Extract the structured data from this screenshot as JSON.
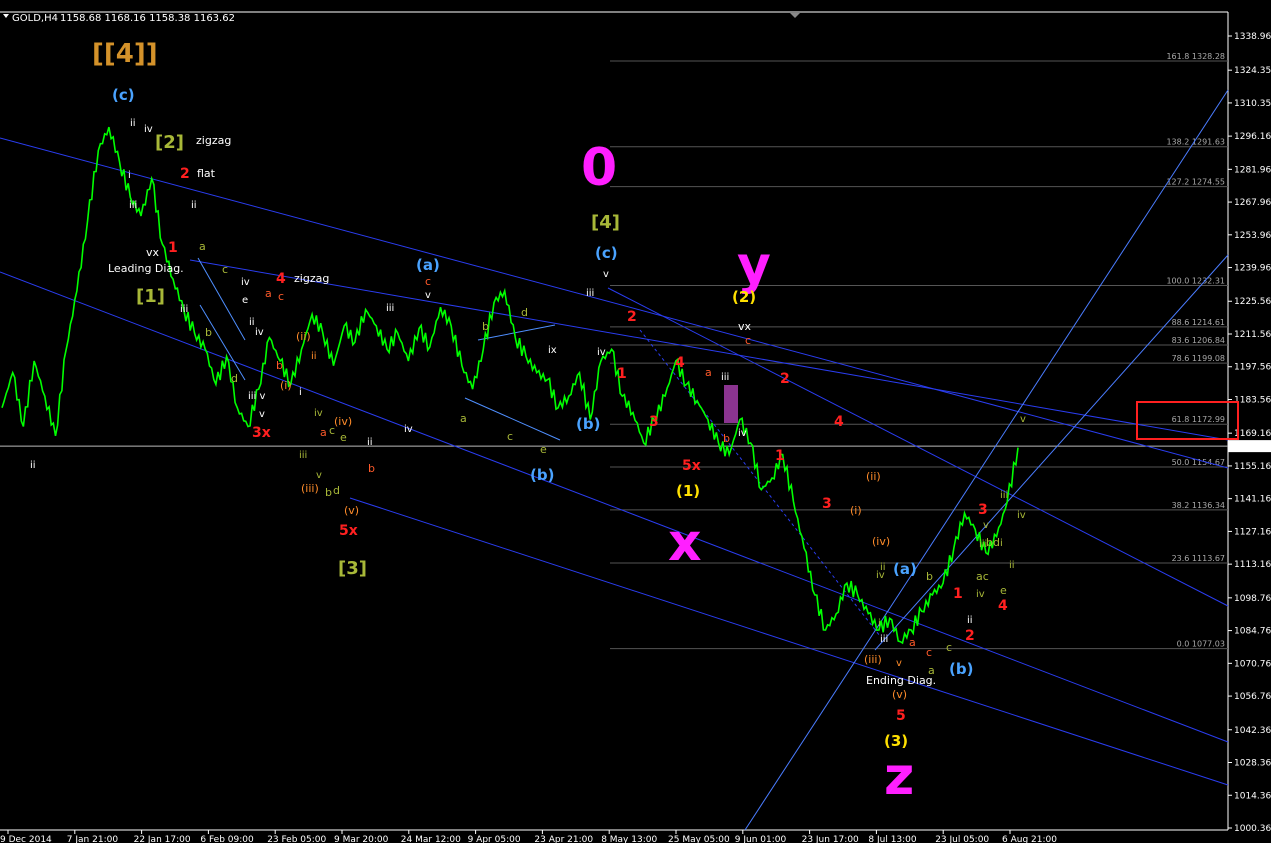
{
  "chart_data": {
    "type": "line",
    "header": {
      "symbol": "GOLD,H4",
      "ohlc": "1158.68 1168.16 1158.38 1163.62"
    },
    "ylim": [
      1000,
      1345
    ],
    "y_ticks": [
      "1338.96",
      "1324.35",
      "1310.35",
      "1296.16",
      "1281.96",
      "1267.96",
      "1253.96",
      "1239.96",
      "1225.56",
      "1211.56",
      "1197.56",
      "1183.56",
      "1169.16",
      "1155.16",
      "1141.16",
      "1127.16",
      "1113.16",
      "1098.76",
      "1084.76",
      "1070.76",
      "1056.76",
      "1042.36",
      "1028.36",
      "1014.36",
      "1000.36"
    ],
    "x_ticks": [
      "9 Dec 2014",
      "7 Jan 21:00",
      "22 Jan 17:00",
      "6 Feb 09:00",
      "23 Feb 05:00",
      "9 Mar 20:00",
      "24 Mar 12:00",
      "9 Apr 05:00",
      "23 Apr 21:00",
      "8 May 13:00",
      "25 May 05:00",
      "9 Jun 01:00",
      "23 Jun 17:00",
      "8 Jul 13:00",
      "23 Jul 05:00",
      "6 Aug 21:00"
    ],
    "current_price": "1163.62",
    "series": [
      {
        "color": "#00ff00",
        "values": [
          1180,
          1195,
          1172,
          1200,
          1185,
          1168,
          1205,
          1230,
          1260,
          1290,
          1300,
          1285,
          1270,
          1262,
          1278,
          1250,
          1235,
          1222,
          1212,
          1205,
          1190,
          1202,
          1180,
          1172,
          1188,
          1210,
          1200,
          1190,
          1205,
          1220,
          1212,
          1198,
          1215,
          1208,
          1222,
          1215,
          1205,
          1212,
          1200,
          1214,
          1206,
          1223,
          1215,
          1198,
          1188,
          1205,
          1225,
          1230,
          1210,
          1202,
          1195,
          1192,
          1180,
          1185,
          1195,
          1175,
          1200,
          1205,
          1185,
          1178,
          1165,
          1175,
          1185,
          1200,
          1190,
          1183,
          1175,
          1165,
          1160,
          1175,
          1165,
          1145,
          1150,
          1160,
          1140,
          1120,
          1100,
          1085,
          1092,
          1105,
          1100,
          1092,
          1085,
          1090,
          1080,
          1085,
          1093,
          1100,
          1105,
          1120,
          1135,
          1128,
          1118,
          1125,
          1140,
          1163
        ]
      }
    ],
    "fibonacci": {
      "color": "#555555",
      "levels": [
        {
          "label": "161.8",
          "value": "1328.28"
        },
        {
          "label": "138.2",
          "value": "1291.63"
        },
        {
          "label": "127.2",
          "value": "1274.55"
        },
        {
          "label": "100.0",
          "value": "1232.31"
        },
        {
          "label": "88.6",
          "value": "1214.61"
        },
        {
          "label": "83.6",
          "value": "1206.84"
        },
        {
          "label": "78.6",
          "value": "1199.08"
        },
        {
          "label": "61.8",
          "value": "1172.99"
        },
        {
          "label": "50.0",
          "value": "1154.67"
        },
        {
          "label": "38.2",
          "value": "1136.34"
        },
        {
          "label": "23.6",
          "value": "1113.67"
        },
        {
          "label": "0.0",
          "value": "1077.03"
        }
      ]
    },
    "annotations": [
      {
        "text": "[[4]]",
        "color": "#d4922a",
        "size": 26
      },
      {
        "text": "(c)",
        "color": "#4aa3ff",
        "size": 15
      },
      {
        "text": "ii",
        "color": "#ffffff",
        "size": 10
      },
      {
        "text": "iv",
        "color": "#ffffff",
        "size": 10
      },
      {
        "text": "[2]",
        "color": "#a8b838",
        "size": 18
      },
      {
        "text": "zigzag",
        "color": "#ffffff",
        "size": 11
      },
      {
        "text": "2",
        "color": "#ff2020",
        "size": 14
      },
      {
        "text": "flat",
        "color": "#ffffff",
        "size": 11
      },
      {
        "text": "i",
        "color": "#ffffff",
        "size": 10
      },
      {
        "text": "iii",
        "color": "#ffffff",
        "size": 10
      },
      {
        "text": "ii",
        "color": "#ffffff",
        "size": 10
      },
      {
        "text": "vx",
        "color": "#ffffff",
        "size": 11
      },
      {
        "text": "1",
        "color": "#ff2020",
        "size": 14
      },
      {
        "text": "Leading Diag.",
        "color": "#ffffff",
        "size": 11
      },
      {
        "text": "[1]",
        "color": "#a8b838",
        "size": 18
      },
      {
        "text": "iii",
        "color": "#ffffff",
        "size": 10
      },
      {
        "text": "a",
        "color": "#a8b838",
        "size": 11
      },
      {
        "text": "c",
        "color": "#a8b838",
        "size": 11
      },
      {
        "text": "iv",
        "color": "#ffffff",
        "size": 10
      },
      {
        "text": "e",
        "color": "#ffffff",
        "size": 10
      },
      {
        "text": "4",
        "color": "#ff2020",
        "size": 14
      },
      {
        "text": "zigzag",
        "color": "#ffffff",
        "size": 11
      },
      {
        "text": "b",
        "color": "#a8b838",
        "size": 11
      },
      {
        "text": "d",
        "color": "#a8b838",
        "size": 11
      },
      {
        "text": "ii",
        "color": "#ffffff",
        "size": 10
      },
      {
        "text": "iv",
        "color": "#ffffff",
        "size": 10
      },
      {
        "text": "a",
        "color": "#ff5a2a",
        "size": 11
      },
      {
        "text": "c",
        "color": "#ff5a2a",
        "size": 11
      },
      {
        "text": "(ii)",
        "color": "#ff8c2a",
        "size": 11
      },
      {
        "text": "ii",
        "color": "#ff8c2a",
        "size": 10
      },
      {
        "text": "b",
        "color": "#ff5a2a",
        "size": 11
      },
      {
        "text": "(i)",
        "color": "#ff8c2a",
        "size": 11
      },
      {
        "text": "iii v",
        "color": "#ffffff",
        "size": 10
      },
      {
        "text": "v",
        "color": "#ffffff",
        "size": 10
      },
      {
        "text": "3x",
        "color": "#ff2020",
        "size": 14
      },
      {
        "text": "i",
        "color": "#ffffff",
        "size": 10
      },
      {
        "text": "iv",
        "color": "#a8b838",
        "size": 10
      },
      {
        "text": "(iv)",
        "color": "#ff8c2a",
        "size": 11
      },
      {
        "text": "a",
        "color": "#ff5a2a",
        "size": 11
      },
      {
        "text": "c",
        "color": "#a8b838",
        "size": 11
      },
      {
        "text": "e",
        "color": "#a8b838",
        "size": 11
      },
      {
        "text": "iii",
        "color": "#a8b838",
        "size": 10
      },
      {
        "text": "v",
        "color": "#a8b838",
        "size": 10
      },
      {
        "text": "b",
        "color": "#a8b838",
        "size": 11
      },
      {
        "text": "d",
        "color": "#a8b838",
        "size": 11
      },
      {
        "text": "(iii)",
        "color": "#ff8c2a",
        "size": 11
      },
      {
        "text": "(v)",
        "color": "#ff8c2a",
        "size": 11
      },
      {
        "text": "5x",
        "color": "#ff2020",
        "size": 14
      },
      {
        "text": "[3]",
        "color": "#a8b838",
        "size": 18
      },
      {
        "text": "ii",
        "color": "#ffffff",
        "size": 10
      },
      {
        "text": "b",
        "color": "#ff5a2a",
        "size": 11
      },
      {
        "text": "iii",
        "color": "#ffffff",
        "size": 10
      },
      {
        "text": "(a)",
        "color": "#4aa3ff",
        "size": 15
      },
      {
        "text": "c",
        "color": "#ff5a2a",
        "size": 11
      },
      {
        "text": "v",
        "color": "#ffffff",
        "size": 10
      },
      {
        "text": "b",
        "color": "#a8b838",
        "size": 11
      },
      {
        "text": "d",
        "color": "#a8b838",
        "size": 11
      },
      {
        "text": "ix",
        "color": "#ffffff",
        "size": 10
      },
      {
        "text": "iv",
        "color": "#ffffff",
        "size": 10
      },
      {
        "text": "a",
        "color": "#a8b838",
        "size": 11
      },
      {
        "text": "c",
        "color": "#a8b838",
        "size": 11
      },
      {
        "text": "e",
        "color": "#a8b838",
        "size": 11
      },
      {
        "text": "(b)",
        "color": "#4aa3ff",
        "size": 15
      },
      {
        "text": "ii",
        "color": "#ffffff",
        "size": 10
      },
      {
        "text": "(b)",
        "color": "#4aa3ff",
        "size": 15
      },
      {
        "text": "0",
        "color": "#ff1fff",
        "size": 52
      },
      {
        "text": "[4]",
        "color": "#a8b838",
        "size": 18
      },
      {
        "text": "(c)",
        "color": "#4aa3ff",
        "size": 15
      },
      {
        "text": "v",
        "color": "#ffffff",
        "size": 10
      },
      {
        "text": "iii",
        "color": "#ffffff",
        "size": 10
      },
      {
        "text": "iv",
        "color": "#ffffff",
        "size": 10
      },
      {
        "text": "2",
        "color": "#ff2020",
        "size": 14
      },
      {
        "text": "1",
        "color": "#ff2020",
        "size": 14
      },
      {
        "text": "4",
        "color": "#ff2020",
        "size": 14
      },
      {
        "text": "3",
        "color": "#ff2020",
        "size": 14
      },
      {
        "text": "5x",
        "color": "#ff2020",
        "size": 14
      },
      {
        "text": "(1)",
        "color": "#ffe000",
        "size": 15
      },
      {
        "text": "x",
        "color": "#ff1fff",
        "size": 52
      },
      {
        "text": "y",
        "color": "#ff1fff",
        "size": 52
      },
      {
        "text": "(2)",
        "color": "#ffe000",
        "size": 15
      },
      {
        "text": "vx",
        "color": "#ffffff",
        "size": 11
      },
      {
        "text": "c",
        "color": "#ff5a2a",
        "size": 11
      },
      {
        "text": "a",
        "color": "#ff5a2a",
        "size": 11
      },
      {
        "text": "iii",
        "color": "#ffffff",
        "size": 10
      },
      {
        "text": "b",
        "color": "#ff5a2a",
        "size": 11
      },
      {
        "text": "iv",
        "color": "#ffffff",
        "size": 10
      },
      {
        "text": "2",
        "color": "#ff2020",
        "size": 14
      },
      {
        "text": "1",
        "color": "#ff2020",
        "size": 14
      },
      {
        "text": "4",
        "color": "#ff2020",
        "size": 14
      },
      {
        "text": "3",
        "color": "#ff2020",
        "size": 14
      },
      {
        "text": "(ii)",
        "color": "#ff8c2a",
        "size": 11
      },
      {
        "text": "(i)",
        "color": "#ff8c2a",
        "size": 11
      },
      {
        "text": "(iv)",
        "color": "#ff8c2a",
        "size": 11
      },
      {
        "text": "ii",
        "color": "#a8b838",
        "size": 10
      },
      {
        "text": "iv",
        "color": "#a8b838",
        "size": 10
      },
      {
        "text": "i",
        "color": "#a8b838",
        "size": 10
      },
      {
        "text": "iii",
        "color": "#ffffff",
        "size": 10
      },
      {
        "text": "(iii)",
        "color": "#ff8c2a",
        "size": 11
      },
      {
        "text": "v",
        "color": "#ff8c2a",
        "size": 10
      },
      {
        "text": "a",
        "color": "#ff5a2a",
        "size": 11
      },
      {
        "text": "c",
        "color": "#ff5a2a",
        "size": 11
      },
      {
        "text": "a",
        "color": "#a8b838",
        "size": 11
      },
      {
        "text": "(a)",
        "color": "#4aa3ff",
        "size": 15
      },
      {
        "text": "b",
        "color": "#a8b838",
        "size": 11
      },
      {
        "text": "c",
        "color": "#a8b838",
        "size": 11
      },
      {
        "text": "Ending Diag.",
        "color": "#ffffff",
        "size": 11
      },
      {
        "text": "(v)",
        "color": "#ff8c2a",
        "size": 11
      },
      {
        "text": "5",
        "color": "#ff2020",
        "size": 14
      },
      {
        "text": "(3)",
        "color": "#ffe000",
        "size": 15
      },
      {
        "text": "z",
        "color": "#ff1fff",
        "size": 52
      },
      {
        "text": "(b)",
        "color": "#4aa3ff",
        "size": 15
      },
      {
        "text": "1",
        "color": "#ff2020",
        "size": 14
      },
      {
        "text": "2",
        "color": "#ff2020",
        "size": 14
      },
      {
        "text": "ii",
        "color": "#ffffff",
        "size": 10
      },
      {
        "text": "iv",
        "color": "#a8b838",
        "size": 10
      },
      {
        "text": "ac",
        "color": "#a8b838",
        "size": 11
      },
      {
        "text": "iii",
        "color": "#a8b838",
        "size": 10
      },
      {
        "text": "v",
        "color": "#a8b838",
        "size": 10
      },
      {
        "text": "bd",
        "color": "#a8b838",
        "size": 11
      },
      {
        "text": "i",
        "color": "#a8b838",
        "size": 10
      },
      {
        "text": "3",
        "color": "#ff2020",
        "size": 14
      },
      {
        "text": "e",
        "color": "#a8b838",
        "size": 11
      },
      {
        "text": "4",
        "color": "#ff2020",
        "size": 14
      },
      {
        "text": "ii",
        "color": "#a8b838",
        "size": 10
      },
      {
        "text": "iii",
        "color": "#a8b838",
        "size": 10
      },
      {
        "text": "iv",
        "color": "#a8b838",
        "size": 10
      },
      {
        "text": "v",
        "color": "#a8b838",
        "size": 10
      }
    ]
  }
}
